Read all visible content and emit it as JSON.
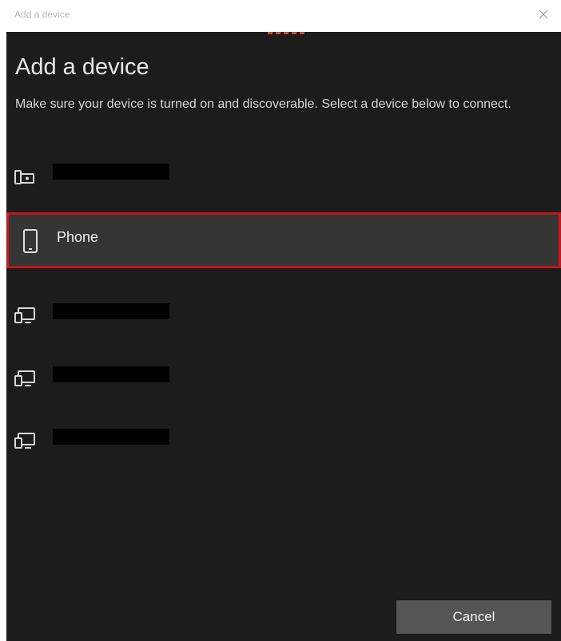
{
  "window": {
    "title": "Add a device",
    "close_icon": "close-icon"
  },
  "dialog": {
    "heading": "Add a device",
    "instructions": "Make sure your device is turned on and discoverable. Select a device below to connect.",
    "progress_dots": 5,
    "accent_color": "#c3161c"
  },
  "devices": [
    {
      "icon": "headset-device-icon",
      "name": "",
      "redacted": true,
      "selected": false
    },
    {
      "icon": "phone-icon",
      "name": "Phone",
      "redacted": false,
      "selected": true
    },
    {
      "icon": "display-device-icon",
      "name": "",
      "redacted": true,
      "selected": false
    },
    {
      "icon": "display-device-icon",
      "name": "",
      "redacted": true,
      "selected": false
    },
    {
      "icon": "display-device-icon",
      "name": "",
      "redacted": true,
      "selected": false
    }
  ],
  "buttons": {
    "cancel_label": "Cancel"
  }
}
